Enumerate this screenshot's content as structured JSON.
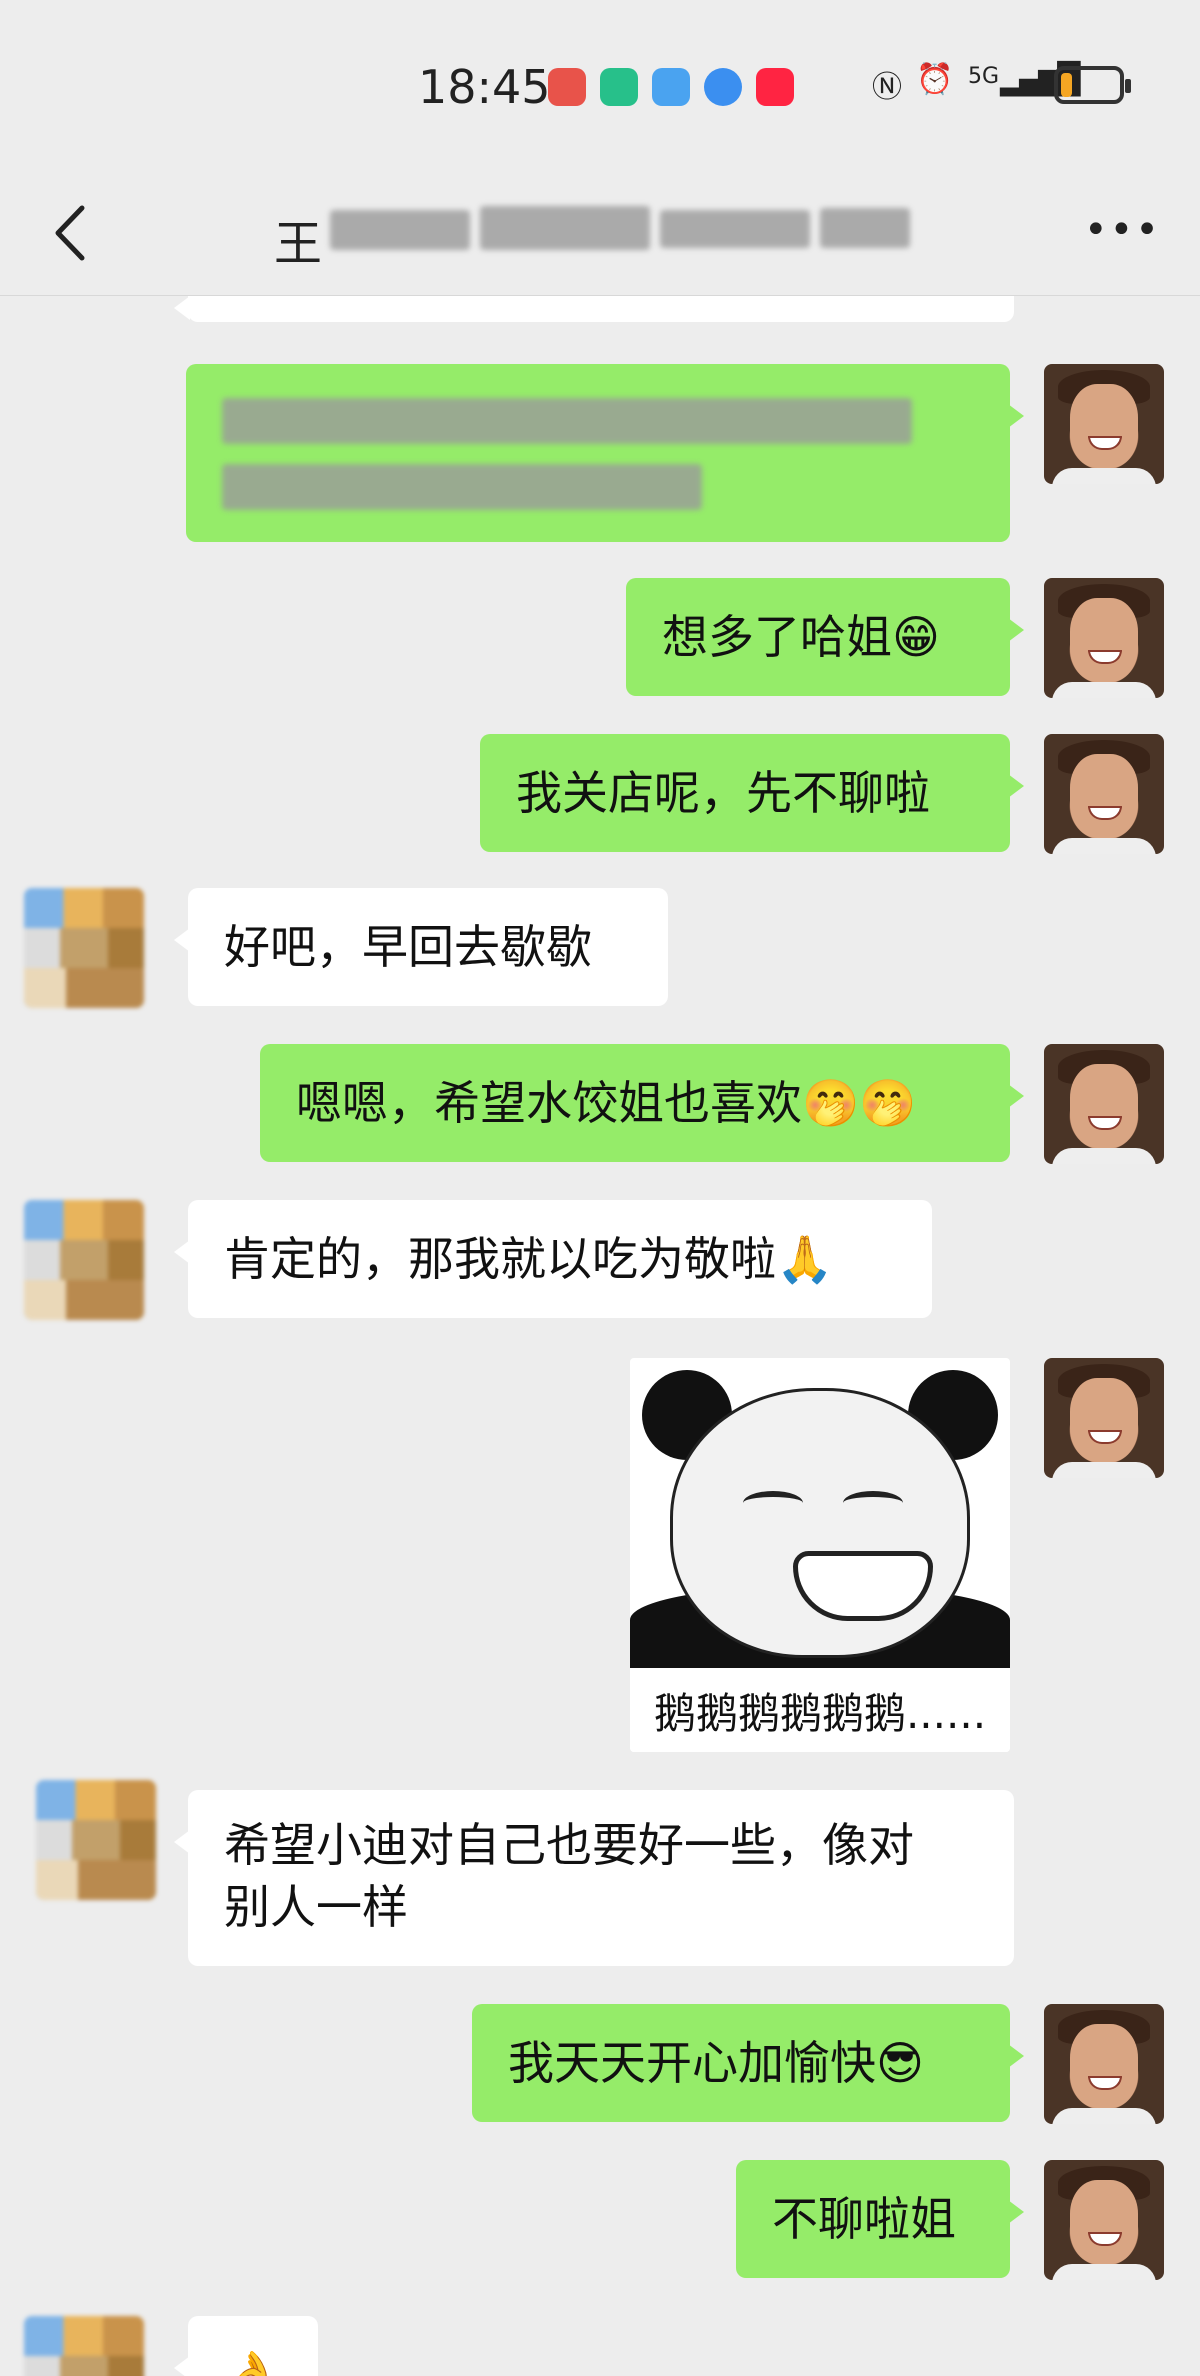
{
  "status_bar": {
    "time": "18:45",
    "signal_label": "5G",
    "battery_level": 0.2
  },
  "header": {
    "title_visible_char": "王"
  },
  "messages": [
    {
      "id": "m0",
      "sender": "other",
      "text": ""
    },
    {
      "id": "m1",
      "sender": "me",
      "text": ""
    },
    {
      "id": "m2",
      "sender": "me",
      "text": "想多了哈姐😁"
    },
    {
      "id": "m3",
      "sender": "me",
      "text": "我关店呢，先不聊啦"
    },
    {
      "id": "m4",
      "sender": "other",
      "text": "好吧，早回去歇歇"
    },
    {
      "id": "m5",
      "sender": "me",
      "text": "嗯嗯，希望水饺姐也喜欢🤭🤭"
    },
    {
      "id": "m6",
      "sender": "other",
      "text": "肯定的，那我就以吃为敬啦🙏"
    },
    {
      "id": "m7",
      "sender": "me",
      "type": "sticker",
      "caption": "鹅鹅鹅鹅鹅鹅......"
    },
    {
      "id": "m8",
      "sender": "other",
      "text_line1": "希望小迪对自己也要好一些，像对",
      "text_line2": "别人一样"
    },
    {
      "id": "m9",
      "sender": "me",
      "text": "我天天开心加愉快😎"
    },
    {
      "id": "m10",
      "sender": "me",
      "text": "不聊啦姐"
    },
    {
      "id": "m11",
      "sender": "other",
      "text": "👌"
    }
  ],
  "colors": {
    "background": "#ededed",
    "my_bubble": "#95ec69",
    "other_bubble": "#ffffff"
  },
  "icons": {
    "back": "chevron-left-icon",
    "more": "more-dots-icon"
  }
}
